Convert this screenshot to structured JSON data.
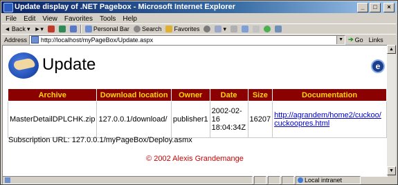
{
  "window": {
    "title": "Update display of .NET Pagebox - Microsoft Internet Explorer"
  },
  "menu": [
    "File",
    "Edit",
    "View",
    "Favorites",
    "Tools",
    "Help"
  ],
  "toolbar": {
    "back": "Back",
    "personal_bar": "Personal Bar",
    "search": "Search",
    "favorites": "Favorites"
  },
  "address": {
    "label": "Address",
    "url": "http://localhost/myPageBox/Update.aspx",
    "go": "Go",
    "links": "Links"
  },
  "page": {
    "heading": "Update",
    "table": {
      "headers": [
        "Archive",
        "Download location",
        "Owner",
        "Date",
        "Size",
        "Documentation"
      ],
      "rows": [
        {
          "archive": "MasterDetailDPLCHK.zip",
          "location": "127.0.0.1/download/",
          "owner": "publisher1",
          "date": "2002-02-16 18:04:34Z",
          "size": "16207",
          "doc": "http://agrandem/home2/cuckoo/cuckoopres.html"
        }
      ]
    },
    "subscription": "Subscription URL: 127.0.0.1/myPageBox/Deploy.asmx",
    "copyright": "© 2002 Alexis Grandemange"
  },
  "status": {
    "zone": "Local intranet"
  },
  "colors": {
    "header_bg": "#8b0000",
    "header_fg": "#ffd700",
    "copyright": "#cc0000"
  }
}
